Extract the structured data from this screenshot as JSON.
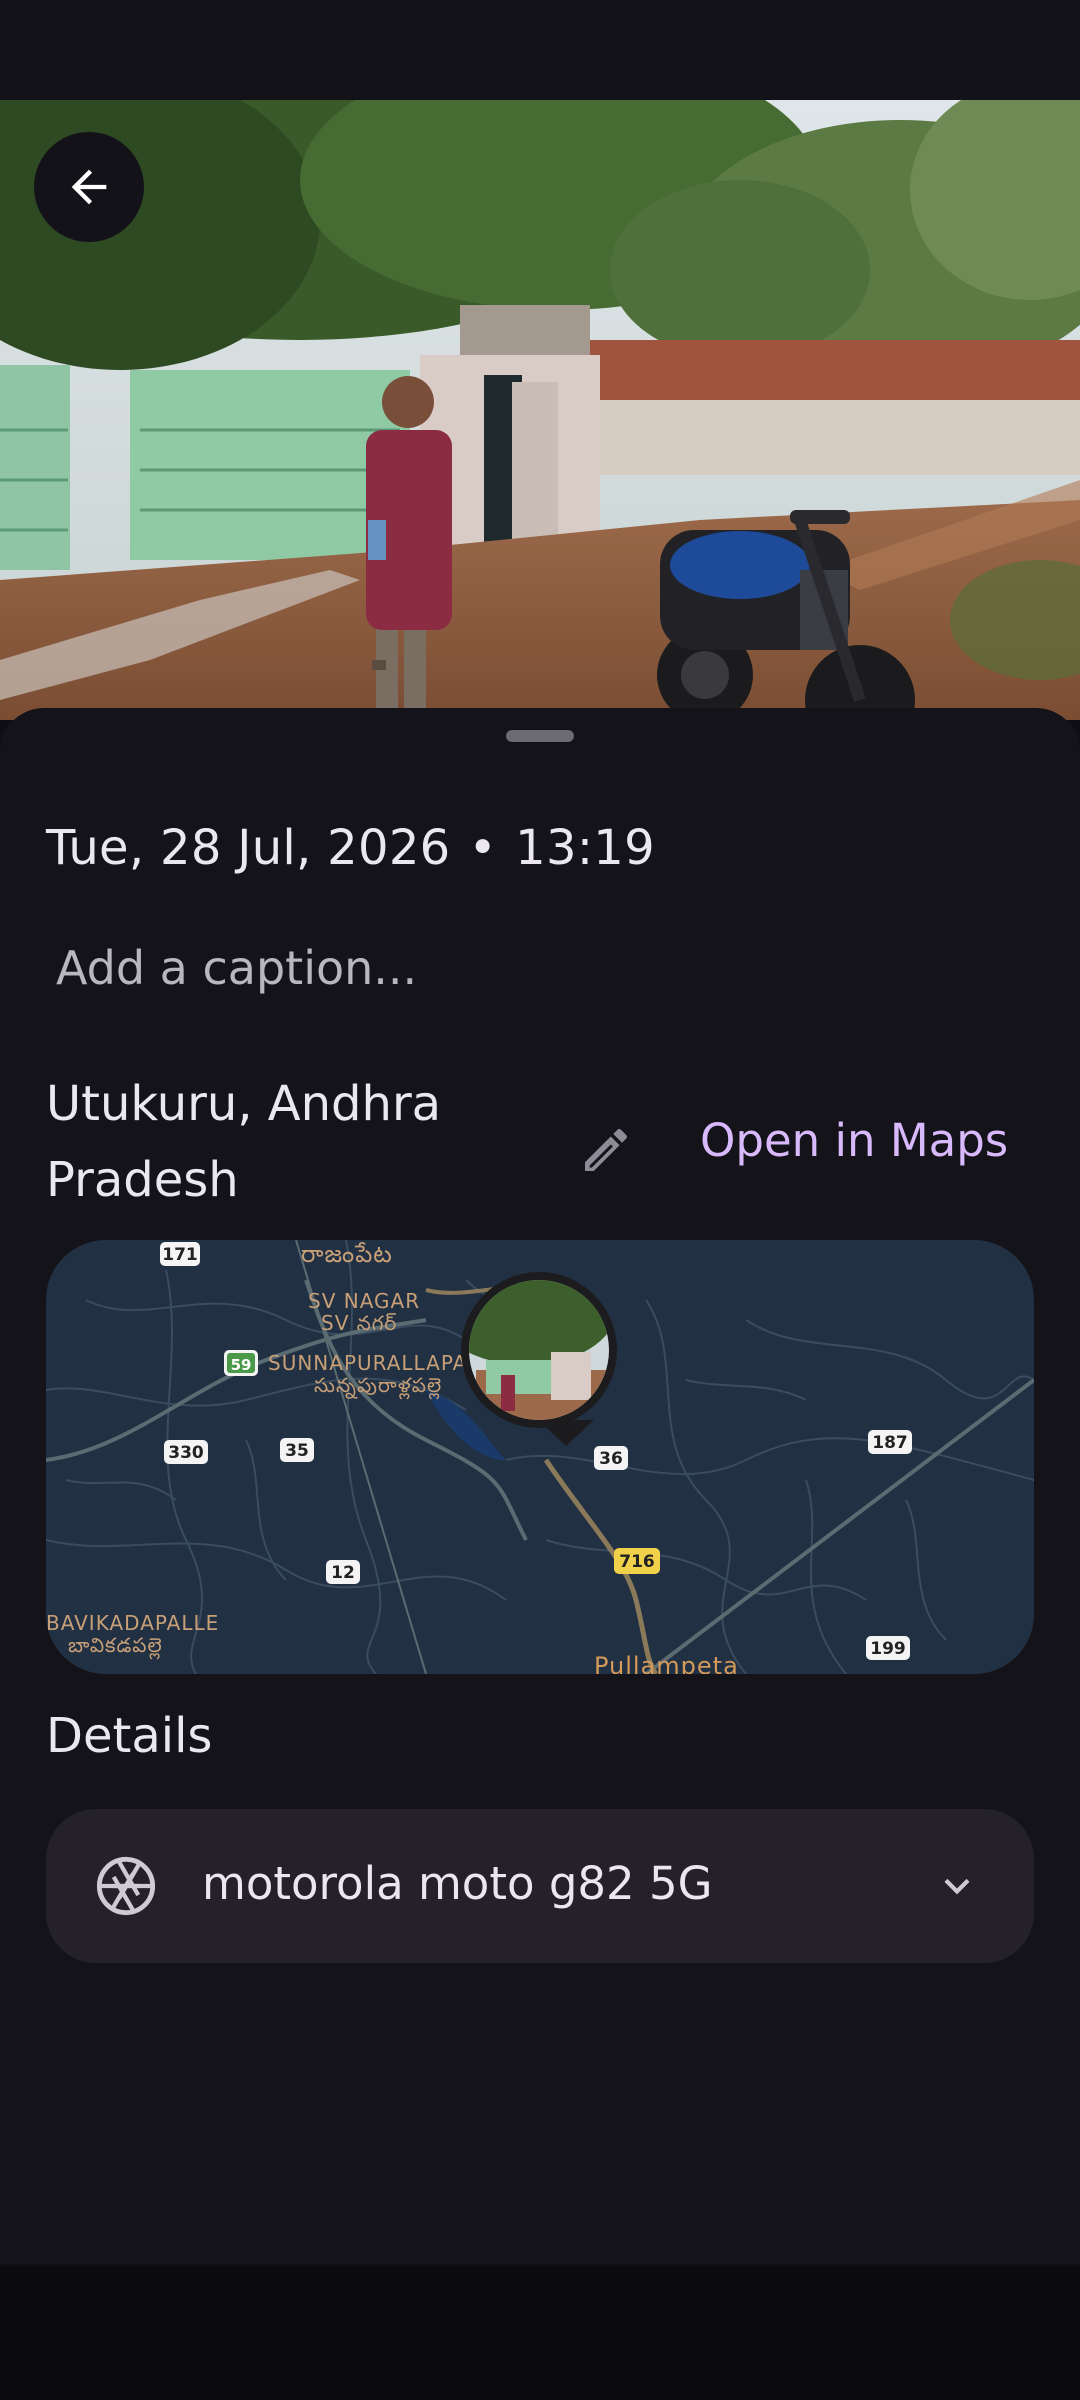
{
  "photo": {
    "back_icon": "arrow-back-icon"
  },
  "info": {
    "date": "Tue, 28 Jul, 2026",
    "separator": "•",
    "time": "13:19",
    "caption_placeholder": "Add a caption..."
  },
  "location": {
    "name": "Utukuru, Andhra Pradesh",
    "edit_icon": "pencil-icon",
    "open_in_maps_label": "Open in Maps"
  },
  "map": {
    "place_labels": [
      "రాజంపేట",
      "SV NAGAR",
      "SV నగర్",
      "SUNNAPURALLAPALLI",
      "సున్నపురాళ్లపల్లె",
      "BAVIKADAPALLE",
      "బావికడపల్లె",
      "Pullampeta"
    ],
    "road_shields": [
      "171",
      "59",
      "330",
      "35",
      "36",
      "187",
      "716",
      "12",
      "199"
    ]
  },
  "details": {
    "heading": "Details",
    "device_icon": "camera-aperture-icon",
    "device_label": "motorola moto g82 5G",
    "expand_icon": "chevron-down-icon"
  },
  "colors": {
    "background": "#15131a",
    "accent": "#d8b9fb",
    "card": "#242129",
    "map": "#213042"
  }
}
